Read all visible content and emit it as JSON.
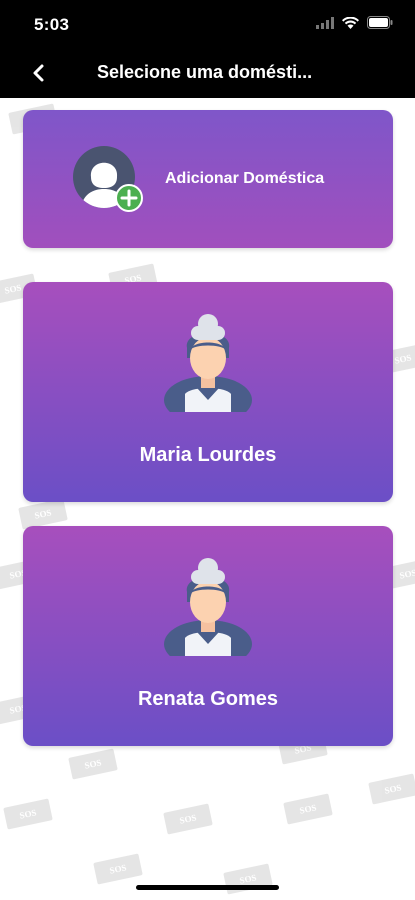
{
  "status_bar": {
    "time": "5:03",
    "icons": [
      "signal-icon",
      "wifi-icon",
      "battery-icon"
    ]
  },
  "nav": {
    "title": "Selecione uma domésti...",
    "back_icon": "chevron-left-icon"
  },
  "add_card": {
    "label": "Adicionar Doméstica",
    "icon": "avatar-add-icon"
  },
  "people": [
    {
      "name": "Maria Lourdes",
      "icon": "maid-avatar-icon"
    },
    {
      "name": "Renata Gomes",
      "icon": "maid-avatar-icon"
    }
  ],
  "watermark": {
    "text": "SOS"
  },
  "colors": {
    "card_gradient_top": "#a74fbd",
    "card_gradient_bottom": "#6b4fc6",
    "plus_badge": "#4caf50"
  }
}
